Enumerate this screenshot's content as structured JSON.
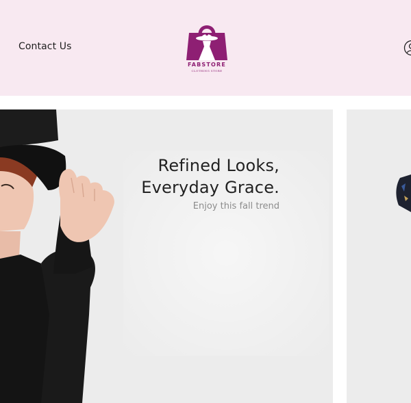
{
  "header": {
    "contact_label": "Contact Us",
    "logo": {
      "brand": "FABSTORE",
      "tagline": "CLOTHING STORE"
    }
  },
  "hero": {
    "title_line1": "Refined Looks,",
    "title_line2": "Everyday Grace.",
    "subtitle": "Enjoy this fall trend"
  },
  "colors": {
    "header_bg": "#f8e9f1",
    "brand": "#8e1f73",
    "slide_bg": "#ececec"
  },
  "icons": [
    "account-icon",
    "shopping-bag-logo-icon"
  ]
}
